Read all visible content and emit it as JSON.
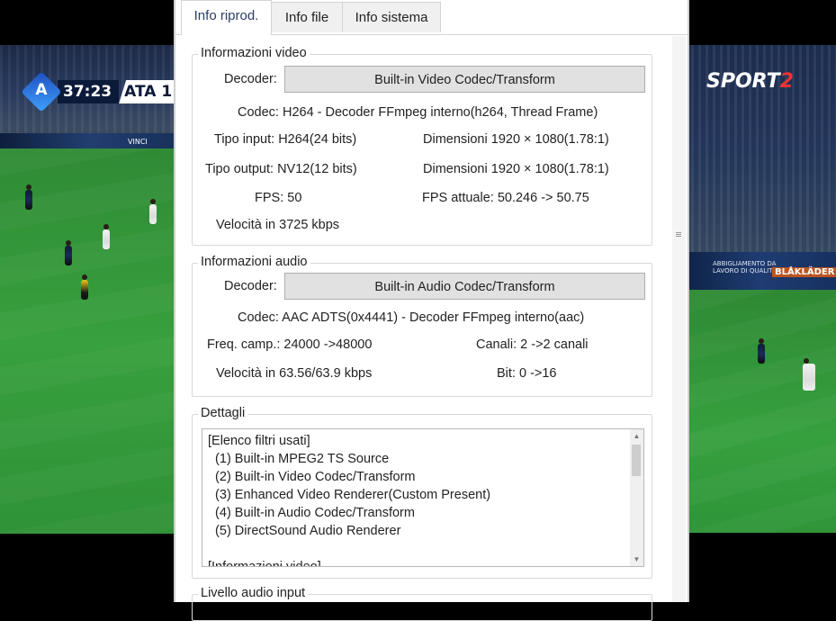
{
  "video": {
    "scoreboard": {
      "league_logo_letter": "A",
      "clock": "37:23",
      "team": "ATA 1"
    },
    "broadcaster": {
      "name": "SPORT",
      "number": "2"
    },
    "adboard_left": "VINCI",
    "adboard_right_small": "ABBIGLIAMENTO DA\nLAVORO DI QUALITÀ",
    "adboard_right_brand": "BLÅKLÄDER"
  },
  "tabs": [
    {
      "label": "Info riprod.",
      "active": true
    },
    {
      "label": "Info file",
      "active": false
    },
    {
      "label": "Info sistema",
      "active": false
    }
  ],
  "video_info": {
    "title": "Informazioni video",
    "decoder_label": "Decoder:",
    "decoder_button": "Built-in Video Codec/Transform",
    "codec": "Codec: H264 - Decoder FFmpeg interno(h264, Thread Frame)",
    "input_type": "Tipo input: H264(24 bits)",
    "input_dims": "Dimensioni 1920 × 1080(1.78:1)",
    "output_type": "Tipo output: NV12(12 bits)",
    "output_dims": "Dimensioni 1920 × 1080(1.78:1)",
    "fps": "FPS: 50",
    "fps_actual": "FPS attuale: 50.246 -> 50.75",
    "bitrate": "Velocità in 3725 kbps"
  },
  "audio_info": {
    "title": "Informazioni audio",
    "decoder_label": "Decoder:",
    "decoder_button": "Built-in Audio Codec/Transform",
    "codec": "Codec: AAC ADTS(0x4441) - Decoder FFmpeg interno(aac)",
    "sample_rate": "Freq. camp.: 24000 ->48000",
    "channels": "Canali: 2 ->2 canali",
    "bitrate": "Velocità in 63.56/63.9 kbps",
    "bits": "Bit: 0 ->16"
  },
  "details": {
    "title": "Dettagli",
    "lines": [
      "[Elenco filtri usati]",
      "  (1) Built-in MPEG2 TS Source",
      "  (2) Built-in Video Codec/Transform",
      "  (3) Enhanced Video Renderer(Custom Present)",
      "  (4) Built-in Audio Codec/Transform",
      "  (5) DirectSound Audio Renderer",
      "",
      "[Informazioni video]"
    ]
  },
  "audio_level": {
    "title": "Livello audio input"
  },
  "colors": {
    "accent_tab_text": "#2c3e66",
    "button_bg": "#e1e1e1",
    "pitch": "#38a03d"
  }
}
